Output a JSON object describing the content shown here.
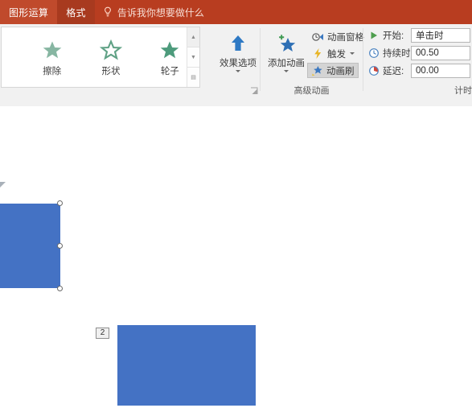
{
  "tabs": [
    {
      "label": "图形运算",
      "state": "normal",
      "name": "tab-shape-operations"
    },
    {
      "label": "格式",
      "state": "active",
      "name": "tab-format"
    }
  ],
  "tell_me": {
    "label": "告诉我你想要做什么",
    "icon": "lightbulb-icon"
  },
  "ribbon": {
    "animation_gallery": {
      "items": [
        {
          "label": "擦除",
          "icon": "star-solid-icon"
        },
        {
          "label": "形状",
          "icon": "star-outline-icon"
        },
        {
          "label": "轮子",
          "icon": "star-wheel-icon"
        }
      ],
      "scroll_up": "▲",
      "scroll_down": "▼",
      "scroll_more": "▤",
      "dialog_launcher": "dialog-launcher-icon"
    },
    "effect_options": {
      "label": "效果选项",
      "icon": "up-arrow-icon"
    },
    "advanced_animation": {
      "group_label": "高级动画",
      "add_animation": {
        "label": "添加动画",
        "icon": "star-plus-icon"
      },
      "buttons": [
        {
          "label": "动画窗格",
          "icon": "animation-pane-icon",
          "pressed": false,
          "has_caret": false
        },
        {
          "label": "触发",
          "icon": "trigger-lightning-icon",
          "pressed": false,
          "has_caret": true
        },
        {
          "label": "动画刷",
          "icon": "animation-painter-icon",
          "pressed": true,
          "has_caret": false
        }
      ]
    },
    "timing": {
      "group_label": "计时",
      "rows": [
        {
          "label": "开始:",
          "value": "单击时",
          "icon": "play-triangle-icon"
        },
        {
          "label": "持续时间:",
          "value": "00.50",
          "icon": "clock-blue-icon"
        },
        {
          "label": "延迟:",
          "value": "00.00",
          "icon": "clock-red-icon"
        }
      ]
    }
  },
  "slide": {
    "shapes": [
      {
        "name": "rectangle-selected",
        "fill": "#4472c4",
        "selected": true
      },
      {
        "name": "rectangle-animated",
        "fill": "#4472c4",
        "selected": false,
        "sequence_badge": "2"
      }
    ]
  }
}
